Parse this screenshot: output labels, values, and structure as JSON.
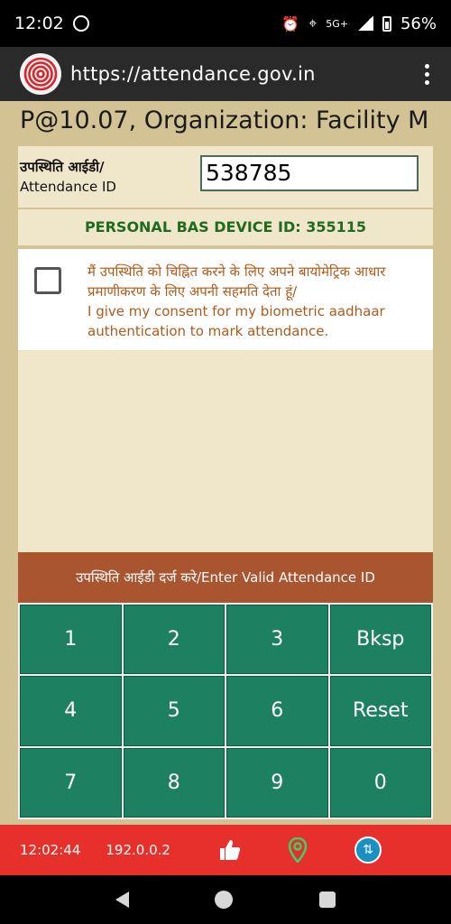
{
  "status_bar": {
    "time": "12:02",
    "network": "5G+",
    "battery": "56%"
  },
  "browser": {
    "url": "https://attendance.gov.in"
  },
  "header": {
    "title": "P@10.07, Organization: Facility M"
  },
  "attendance": {
    "label_hindi": "उपस्थिति आईडी/",
    "label_english": "Attendance ID",
    "value": "538785"
  },
  "device": {
    "text": "PERSONAL BAS DEVICE ID: 355115"
  },
  "consent": {
    "hindi": "मैं उपस्थिति को चिह्नित करने के लिए अपने बायोमेट्रिक आधार प्रमाणीकरण के लिए अपनी सहमति देता हूं/",
    "english": "I give my consent for my biometric aadhaar authentication to mark attendance."
  },
  "message": "उपस्थिति आईडी दर्ज करे/Enter Valid Attendance ID",
  "keypad": {
    "keys": [
      "1",
      "2",
      "3",
      "Bksp",
      "4",
      "5",
      "6",
      "Reset",
      "7",
      "8",
      "9",
      "0"
    ]
  },
  "footer": {
    "time": "12:02:44",
    "ip": "192.0.0.2",
    "sync_icon": "sync-icon"
  },
  "colors": {
    "keypad": "#1d8060",
    "message_bar": "#a85530",
    "footer": "#e7302b",
    "device_text": "#1f6b1f",
    "consent_text": "#b05a1a"
  }
}
